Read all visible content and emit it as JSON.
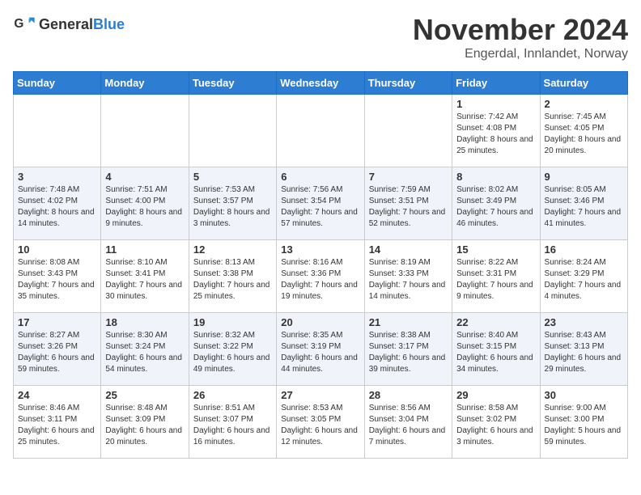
{
  "header": {
    "logo_general": "General",
    "logo_blue": "Blue",
    "month": "November 2024",
    "location": "Engerdal, Innlandet, Norway"
  },
  "days_of_week": [
    "Sunday",
    "Monday",
    "Tuesday",
    "Wednesday",
    "Thursday",
    "Friday",
    "Saturday"
  ],
  "weeks": [
    [
      {
        "day": "",
        "detail": ""
      },
      {
        "day": "",
        "detail": ""
      },
      {
        "day": "",
        "detail": ""
      },
      {
        "day": "",
        "detail": ""
      },
      {
        "day": "",
        "detail": ""
      },
      {
        "day": "1",
        "detail": "Sunrise: 7:42 AM\nSunset: 4:08 PM\nDaylight: 8 hours and 25 minutes."
      },
      {
        "day": "2",
        "detail": "Sunrise: 7:45 AM\nSunset: 4:05 PM\nDaylight: 8 hours and 20 minutes."
      }
    ],
    [
      {
        "day": "3",
        "detail": "Sunrise: 7:48 AM\nSunset: 4:02 PM\nDaylight: 8 hours and 14 minutes."
      },
      {
        "day": "4",
        "detail": "Sunrise: 7:51 AM\nSunset: 4:00 PM\nDaylight: 8 hours and 9 minutes."
      },
      {
        "day": "5",
        "detail": "Sunrise: 7:53 AM\nSunset: 3:57 PM\nDaylight: 8 hours and 3 minutes."
      },
      {
        "day": "6",
        "detail": "Sunrise: 7:56 AM\nSunset: 3:54 PM\nDaylight: 7 hours and 57 minutes."
      },
      {
        "day": "7",
        "detail": "Sunrise: 7:59 AM\nSunset: 3:51 PM\nDaylight: 7 hours and 52 minutes."
      },
      {
        "day": "8",
        "detail": "Sunrise: 8:02 AM\nSunset: 3:49 PM\nDaylight: 7 hours and 46 minutes."
      },
      {
        "day": "9",
        "detail": "Sunrise: 8:05 AM\nSunset: 3:46 PM\nDaylight: 7 hours and 41 minutes."
      }
    ],
    [
      {
        "day": "10",
        "detail": "Sunrise: 8:08 AM\nSunset: 3:43 PM\nDaylight: 7 hours and 35 minutes."
      },
      {
        "day": "11",
        "detail": "Sunrise: 8:10 AM\nSunset: 3:41 PM\nDaylight: 7 hours and 30 minutes."
      },
      {
        "day": "12",
        "detail": "Sunrise: 8:13 AM\nSunset: 3:38 PM\nDaylight: 7 hours and 25 minutes."
      },
      {
        "day": "13",
        "detail": "Sunrise: 8:16 AM\nSunset: 3:36 PM\nDaylight: 7 hours and 19 minutes."
      },
      {
        "day": "14",
        "detail": "Sunrise: 8:19 AM\nSunset: 3:33 PM\nDaylight: 7 hours and 14 minutes."
      },
      {
        "day": "15",
        "detail": "Sunrise: 8:22 AM\nSunset: 3:31 PM\nDaylight: 7 hours and 9 minutes."
      },
      {
        "day": "16",
        "detail": "Sunrise: 8:24 AM\nSunset: 3:29 PM\nDaylight: 7 hours and 4 minutes."
      }
    ],
    [
      {
        "day": "17",
        "detail": "Sunrise: 8:27 AM\nSunset: 3:26 PM\nDaylight: 6 hours and 59 minutes."
      },
      {
        "day": "18",
        "detail": "Sunrise: 8:30 AM\nSunset: 3:24 PM\nDaylight: 6 hours and 54 minutes."
      },
      {
        "day": "19",
        "detail": "Sunrise: 8:32 AM\nSunset: 3:22 PM\nDaylight: 6 hours and 49 minutes."
      },
      {
        "day": "20",
        "detail": "Sunrise: 8:35 AM\nSunset: 3:19 PM\nDaylight: 6 hours and 44 minutes."
      },
      {
        "day": "21",
        "detail": "Sunrise: 8:38 AM\nSunset: 3:17 PM\nDaylight: 6 hours and 39 minutes."
      },
      {
        "day": "22",
        "detail": "Sunrise: 8:40 AM\nSunset: 3:15 PM\nDaylight: 6 hours and 34 minutes."
      },
      {
        "day": "23",
        "detail": "Sunrise: 8:43 AM\nSunset: 3:13 PM\nDaylight: 6 hours and 29 minutes."
      }
    ],
    [
      {
        "day": "24",
        "detail": "Sunrise: 8:46 AM\nSunset: 3:11 PM\nDaylight: 6 hours and 25 minutes."
      },
      {
        "day": "25",
        "detail": "Sunrise: 8:48 AM\nSunset: 3:09 PM\nDaylight: 6 hours and 20 minutes."
      },
      {
        "day": "26",
        "detail": "Sunrise: 8:51 AM\nSunset: 3:07 PM\nDaylight: 6 hours and 16 minutes."
      },
      {
        "day": "27",
        "detail": "Sunrise: 8:53 AM\nSunset: 3:05 PM\nDaylight: 6 hours and 12 minutes."
      },
      {
        "day": "28",
        "detail": "Sunrise: 8:56 AM\nSunset: 3:04 PM\nDaylight: 6 hours and 7 minutes."
      },
      {
        "day": "29",
        "detail": "Sunrise: 8:58 AM\nSunset: 3:02 PM\nDaylight: 6 hours and 3 minutes."
      },
      {
        "day": "30",
        "detail": "Sunrise: 9:00 AM\nSunset: 3:00 PM\nDaylight: 5 hours and 59 minutes."
      }
    ]
  ]
}
